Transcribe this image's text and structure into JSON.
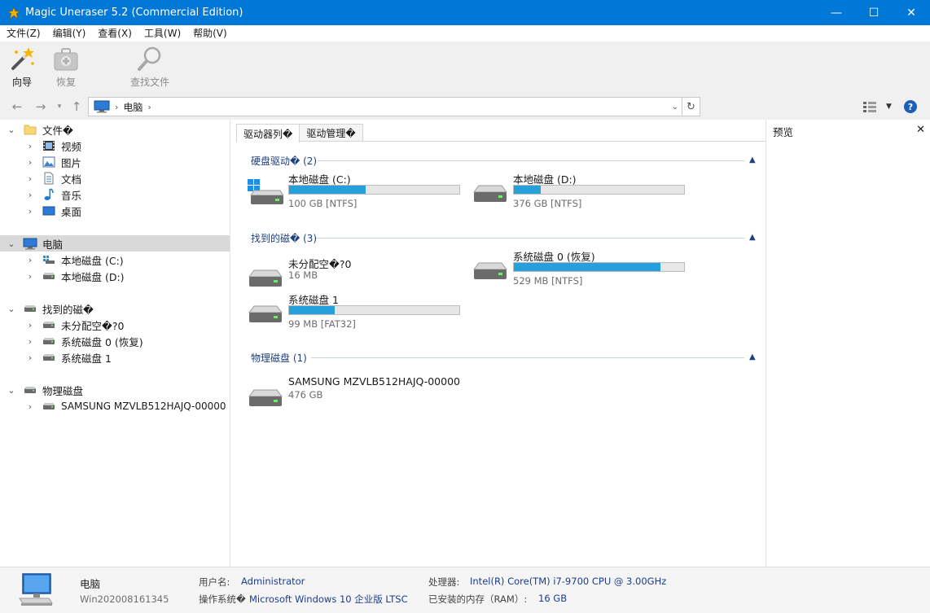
{
  "window": {
    "title": "Magic Uneraser 5.2 (Commercial Edition)",
    "minimize": "—",
    "maximize": "☐",
    "close": "✕"
  },
  "menu": [
    "文件(Z)",
    "编辑(Y)",
    "查看(X)",
    "工具(W)",
    "帮助(V)"
  ],
  "toolbar": {
    "wizard": "向导",
    "recover": "恢复",
    "find_files": "查找文件"
  },
  "address": {
    "crumb": "电脑",
    "sep1": "›",
    "sep2": "›"
  },
  "tree": {
    "files": "文件�",
    "videos": "视频",
    "pictures": "图片",
    "documents": "文档",
    "music": "音乐",
    "desktop": "桌面",
    "computer": "电脑",
    "drive_c": "本地磁盘 (C:)",
    "drive_d": "本地磁盘 (D:)",
    "found": "找到的磁�",
    "unallocated": "未分配空�?0",
    "sys0": "系统磁盘 0 (恢复)",
    "sys1": "系统磁盘 1",
    "physical": "物理磁盘",
    "samsung": "SAMSUNG MZVLB512HAJQ-00000"
  },
  "tabs": [
    "驱动器列�",
    "驱动管理�"
  ],
  "groups": {
    "hard": "硬盘驱动� (2)",
    "found": "找到的磁� (3)",
    "physical": "物理磁盘 (1)"
  },
  "drives": {
    "c": {
      "name": "本地磁盘 (C:)",
      "info": "100 GB [NTFS]",
      "used": 0.45
    },
    "d": {
      "name": "本地磁盘 (D:)",
      "info": "376 GB [NTFS]",
      "used": 0.16
    },
    "unalloc": {
      "name": "未分配空�?0",
      "info": "16 MB"
    },
    "sys0": {
      "name": "系统磁盘 0 (恢复)",
      "info": "529 MB [NTFS]",
      "used": 0.86
    },
    "sys1": {
      "name": "系统磁盘 1",
      "info": "99 MB [FAT32]",
      "used": 0.27
    },
    "samsung": {
      "name": "SAMSUNG MZVLB512HAJQ-00000",
      "info": "476 GB"
    }
  },
  "preview": {
    "title": "预览",
    "close": "✕"
  },
  "status": {
    "pc_name": "电脑",
    "pc_id": "Win202008161345",
    "user_label": "用户名:",
    "user_value": "Administrator",
    "os_label": "操作系统�",
    "os_value": "Microsoft Windows 10 企业版 LTSC",
    "cpu_label": "处理器:",
    "cpu_value": "Intel(R) Core(TM) i7-9700 CPU @ 3.00GHz",
    "ram_label": "已安装的内存（RAM）:",
    "ram_value": "16 GB"
  },
  "colors": {
    "titlebar": "#0078d7",
    "bar_fill": "#26a0da",
    "group_text": "#1e3f82"
  }
}
